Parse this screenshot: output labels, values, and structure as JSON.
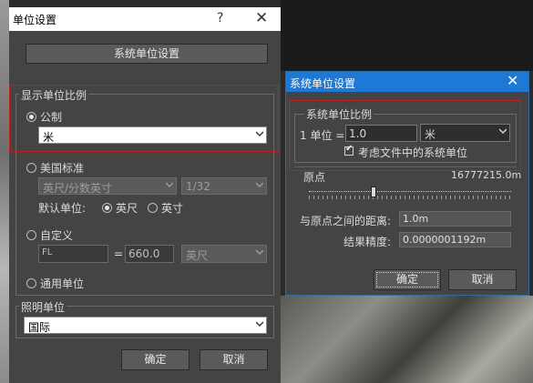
{
  "dialog1": {
    "title": "单位设置",
    "help_glyph": "?",
    "close_glyph": "✕",
    "system_units_button": "系统单位设置",
    "display_scale": {
      "group_title": "显示单位比例",
      "metric": {
        "label": "公制",
        "selected": true,
        "value": "米"
      },
      "us_standard": {
        "label": "美国标准",
        "selected": false,
        "unit_value": "英尺/分数英寸",
        "fraction_value": "1/32",
        "default_unit_label": "默认单位:",
        "default_unit_options": [
          {
            "label": "英尺",
            "selected": true
          },
          {
            "label": "英寸",
            "selected": false
          }
        ]
      },
      "custom": {
        "label": "自定义",
        "selected": false,
        "name_value": "FL",
        "equals": "=",
        "amount_value": "660.0",
        "unit_value": "英尺"
      },
      "generic": {
        "label": "通用单位",
        "selected": false
      }
    },
    "lighting": {
      "group_title": "照明单位",
      "value": "国际"
    },
    "ok_button": "确定",
    "cancel_button": "取消"
  },
  "dialog2": {
    "title": "系统单位设置",
    "close_glyph": "✕",
    "scale_group_title": "系统单位比例",
    "unit_label": "1 单位 =",
    "unit_amount": "1.0",
    "unit_value": "米",
    "consider_files_label": "考虑文件中的系统单位",
    "consider_files_checked": true,
    "origin_label": "原点",
    "origin_value": "16777215.0m",
    "distance_label": "与原点之间的距离:",
    "distance_value": "1.0m",
    "precision_label": "结果精度:",
    "precision_value": "0.0000001192m",
    "ok_button": "确定",
    "cancel_button": "取消"
  },
  "colors": {
    "dialog_bg": "#444444",
    "highlight_red": "#c21f1f",
    "active_title_blue": "#1e78d6"
  }
}
